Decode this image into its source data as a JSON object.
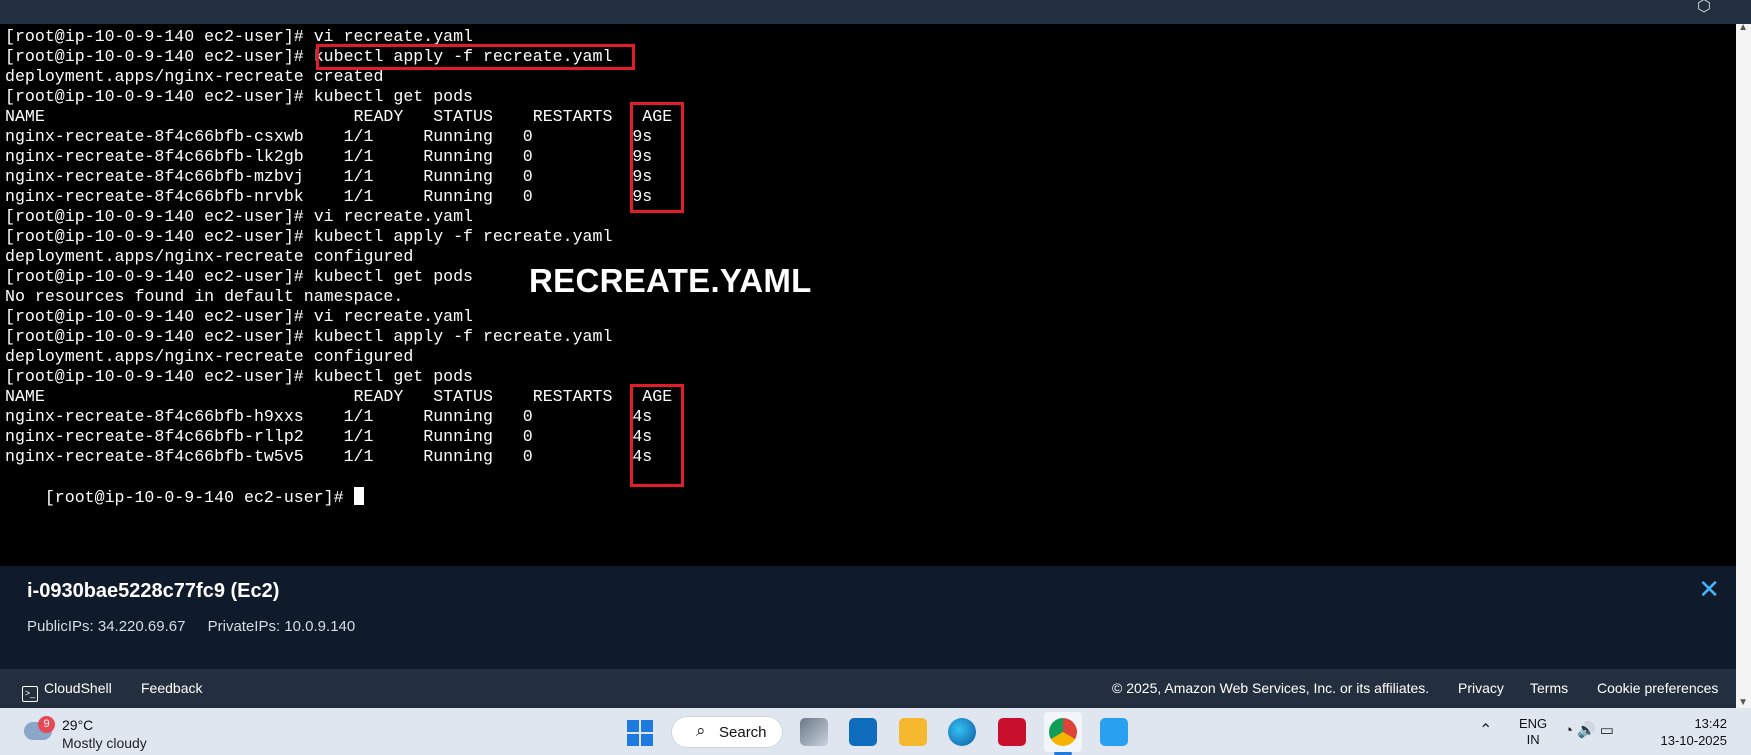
{
  "terminal": {
    "lines": [
      "[root@ip-10-0-9-140 ec2-user]# vi recreate.yaml",
      "[root@ip-10-0-9-140 ec2-user]# kubectl apply -f recreate.yaml",
      "deployment.apps/nginx-recreate created",
      "[root@ip-10-0-9-140 ec2-user]# kubectl get pods",
      "NAME                               READY   STATUS    RESTARTS   AGE",
      "nginx-recreate-8f4c66bfb-csxwb    1/1     Running   0          9s",
      "nginx-recreate-8f4c66bfb-lk2gb    1/1     Running   0          9s",
      "nginx-recreate-8f4c66bfb-mzbvj    1/1     Running   0          9s",
      "nginx-recreate-8f4c66bfb-nrvbk    1/1     Running   0          9s",
      "[root@ip-10-0-9-140 ec2-user]# vi recreate.yaml",
      "[root@ip-10-0-9-140 ec2-user]# kubectl apply -f recreate.yaml",
      "deployment.apps/nginx-recreate configured",
      "[root@ip-10-0-9-140 ec2-user]# kubectl get pods",
      "No resources found in default namespace.",
      "[root@ip-10-0-9-140 ec2-user]# vi recreate.yaml",
      "[root@ip-10-0-9-140 ec2-user]# kubectl apply -f recreate.yaml",
      "deployment.apps/nginx-recreate configured",
      "[root@ip-10-0-9-140 ec2-user]# kubectl get pods",
      "NAME                               READY   STATUS    RESTARTS   AGE",
      "nginx-recreate-8f4c66bfb-h9xxs    1/1     Running   0          4s",
      "nginx-recreate-8f4c66bfb-rllp2    1/1     Running   0          4s",
      "nginx-recreate-8f4c66bfb-tw5v5    1/1     Running   0          4s"
    ],
    "prompt": "[root@ip-10-0-9-140 ec2-user]# ",
    "overlay_title": "RECREATE.YAML",
    "highlight_color": "#e11d2b"
  },
  "instance": {
    "title": "i-0930bae5228c77fc9 (Ec2)",
    "public_ips": "PublicIPs: 34.220.69.67",
    "private_ips": "PrivateIPs: 10.0.9.140"
  },
  "footer": {
    "cloudshell": "CloudShell",
    "feedback": "Feedback",
    "copyright": "© 2025, Amazon Web Services, Inc. or its affiliates.",
    "privacy": "Privacy",
    "terms": "Terms",
    "cookie": "Cookie preferences"
  },
  "taskbar": {
    "weather_badge": "9",
    "temperature": "29°C",
    "weather_desc": "Mostly cloudy",
    "search_label": "Search",
    "lang_top": "ENG",
    "lang_bottom": "IN",
    "time": "13:42",
    "date": "13-10-2025"
  }
}
